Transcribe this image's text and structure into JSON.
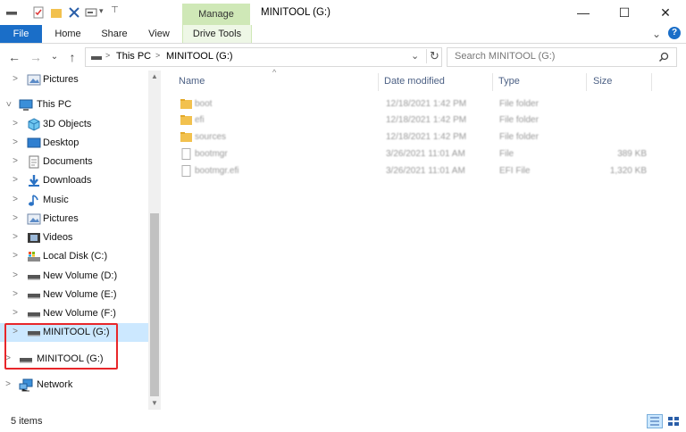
{
  "window": {
    "title": "MINITOOL (G:)",
    "manage_label": "Manage",
    "minimize": "—",
    "maximize": "☐",
    "close": "✕"
  },
  "ribbon": {
    "tabs": [
      "File",
      "Home",
      "Share",
      "View",
      "Drive Tools"
    ],
    "chevron": "⌄",
    "help": "?"
  },
  "address": {
    "back": "←",
    "forward": "→",
    "history": "⌄",
    "up": "↑",
    "crumbs": [
      "This PC",
      "MINITOOL (G:)"
    ],
    "separator": ">",
    "dropdown": "⌄",
    "refresh": "↻",
    "search_placeholder": "Search MINITOOL (G:)"
  },
  "nav": {
    "items": [
      {
        "label": "Pictures",
        "icon": "pictures-icon"
      },
      {
        "label": "This PC",
        "icon": "computer-icon",
        "expanded": true
      },
      {
        "label": "3D Objects",
        "icon": "3d-objects-icon"
      },
      {
        "label": "Desktop",
        "icon": "desktop-icon"
      },
      {
        "label": "Documents",
        "icon": "documents-icon"
      },
      {
        "label": "Downloads",
        "icon": "downloads-icon"
      },
      {
        "label": "Music",
        "icon": "music-icon"
      },
      {
        "label": "Pictures",
        "icon": "pictures-icon"
      },
      {
        "label": "Videos",
        "icon": "videos-icon"
      },
      {
        "label": "Local Disk (C:)",
        "icon": "local-disk-icon"
      },
      {
        "label": "New Volume (D:)",
        "icon": "drive-icon"
      },
      {
        "label": "New Volume (E:)",
        "icon": "drive-icon"
      },
      {
        "label": "New Volume (F:)",
        "icon": "drive-icon"
      },
      {
        "label": "MINITOOL (G:)",
        "icon": "drive-icon",
        "selected": true
      },
      {
        "label": "MINITOOL (G:)",
        "icon": "drive-icon"
      },
      {
        "label": "Network",
        "icon": "network-icon"
      }
    ]
  },
  "columns": [
    "Name",
    "Date modified",
    "Type",
    "Size"
  ],
  "sort_indicator": "^",
  "files": [
    {
      "name": "boot",
      "date": "12/18/2021 1:42 PM",
      "type": "File folder",
      "size": "",
      "kind": "folder"
    },
    {
      "name": "efi",
      "date": "12/18/2021 1:42 PM",
      "type": "File folder",
      "size": "",
      "kind": "folder"
    },
    {
      "name": "sources",
      "date": "12/18/2021 1:42 PM",
      "type": "File folder",
      "size": "",
      "kind": "folder"
    },
    {
      "name": "bootmgr",
      "date": "3/26/2021 11:01 AM",
      "type": "File",
      "size": "389 KB",
      "kind": "file"
    },
    {
      "name": "bootmgr.efi",
      "date": "3/26/2021 11:01 AM",
      "type": "EFI File",
      "size": "1,320 KB",
      "kind": "file"
    }
  ],
  "status": {
    "count": "5 items"
  },
  "colors": {
    "file_tab": "#1a6ec8",
    "manage_tab": "#cfe8b7",
    "selection": "#cce8ff",
    "highlight": "#e8262a",
    "folder": "#f2c14e"
  }
}
